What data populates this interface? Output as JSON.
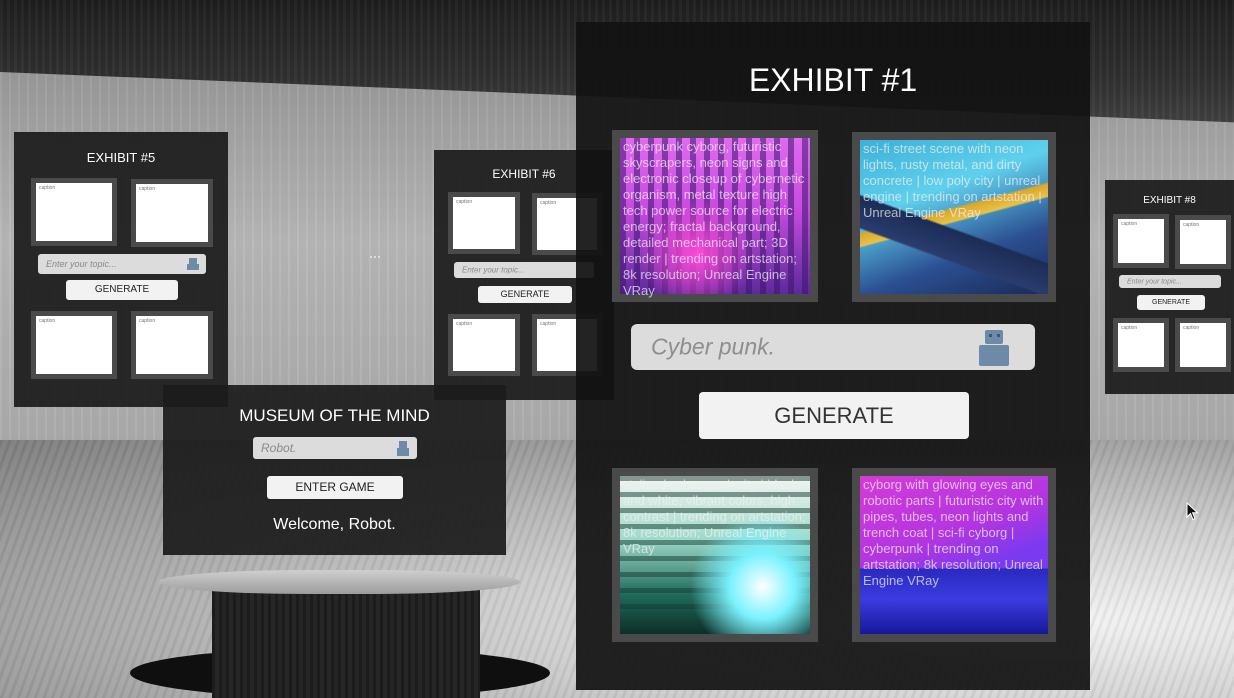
{
  "museum": {
    "title": "MUSEUM OF THE MIND",
    "name_value": "Robot.",
    "enter_label": "ENTER GAME",
    "welcome": "Welcome, Robot."
  },
  "exhibit5": {
    "title": "EXHIBIT #5",
    "captions": [
      "caption",
      "caption",
      "caption",
      "caption"
    ],
    "placeholder": "Enter your topic...",
    "generate_label": "GENERATE"
  },
  "exhibit6": {
    "title": "EXHIBIT #6",
    "captions": [
      "caption",
      "caption",
      "caption",
      "caption"
    ],
    "placeholder": "Enter your topic...",
    "generate_label": "GENERATE"
  },
  "exhibit8": {
    "title": "EXHIBIT #8",
    "captions": [
      "caption",
      "caption",
      "caption",
      "caption"
    ],
    "placeholder": "Enter your topic...",
    "generate_label": "GENERATE"
  },
  "exhibit1": {
    "title": "EXHIBIT #1",
    "topic_value": "Cyber punk.",
    "generate_label": "GENERATE",
    "images": [
      {
        "caption": "cyberpunk cyborg, futuristic skyscrapers, neon signs and electronic closeup of cybernetic organism, metal texture high tech power source for electric energy; fractal background, detailed mechanical part; 3D render | trending on artstation; 8k resolution; Unreal Engine VRay"
      },
      {
        "caption": "sci-fi street scene with neon lights, rusty metal, and dirty concrete | low poly city | unreal engine | trending on artstation | Unreal Engine VRay"
      },
      {
        "caption": "stylized cyber punk city | black and white, vibrant colors, high contrast | trending on artstation; 8k resolution; Unreal Engine VRay"
      },
      {
        "caption": "cyborg with glowing eyes and robotic parts | futuristic city with pipes, tubes, neon lights and trench coat | sci-fi cyborg | cyberpunk | trending on artstation; 8k resolution; Unreal Engine VRay"
      }
    ]
  },
  "colors": {
    "panel": "#1c1c1c",
    "frame": "#4a4a4a",
    "button": "#f2f2f2",
    "field": "#dcdcdc"
  },
  "icons": [
    "robot-icon",
    "mouse-cursor-icon"
  ]
}
